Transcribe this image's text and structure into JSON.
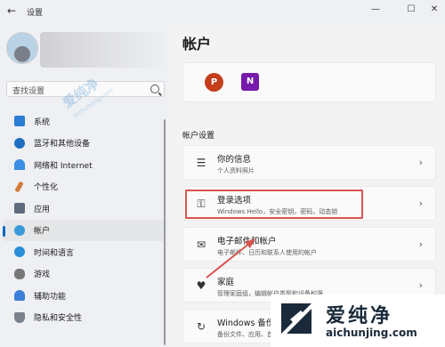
{
  "window": {
    "title": "设置",
    "back_glyph": "←",
    "controls": [
      "—",
      "☐",
      "✕"
    ]
  },
  "search": {
    "placeholder": "查找设置"
  },
  "sidebar": {
    "items": [
      {
        "label": "系统",
        "icon": "system-icon",
        "color": "#2b7cd3"
      },
      {
        "label": "蓝牙和其他设备",
        "icon": "bluetooth-icon",
        "color": "#1f6fbf"
      },
      {
        "label": "网络和 Internet",
        "icon": "wifi-icon",
        "color": "#3a8ee6"
      },
      {
        "label": "个性化",
        "icon": "brush-icon",
        "color": "#d07a3b"
      },
      {
        "label": "应用",
        "icon": "apps-icon",
        "color": "#5d6b7c"
      },
      {
        "label": "帐户",
        "icon": "account-icon",
        "color": "#3a9ad9",
        "active": true
      },
      {
        "label": "时间和语言",
        "icon": "globe-icon",
        "color": "#2a8fd8"
      },
      {
        "label": "游戏",
        "icon": "game-icon",
        "color": "#777777"
      },
      {
        "label": "辅助功能",
        "icon": "accessibility-icon",
        "color": "#3b7dd8"
      },
      {
        "label": "隐私和安全性",
        "icon": "shield-icon",
        "color": "#7a828c"
      }
    ]
  },
  "main": {
    "title": "帐户",
    "apps": [
      {
        "name": "PowerPoint",
        "glyph": "P"
      },
      {
        "name": "OneNote",
        "glyph": "N"
      }
    ],
    "section_title": "帐户设置",
    "cards": [
      {
        "title": "你的信息",
        "sub": "个人资料照片",
        "icon_glyph": "☰"
      },
      {
        "title": "登录选项",
        "sub": "Windows Hello，安全密钥，密码，动态锁",
        "icon_glyph": "⚿"
      },
      {
        "title": "电子邮件和帐户",
        "sub": "电子邮件、日历和联系人使用的帐户",
        "icon_glyph": "✉"
      },
      {
        "title": "家庭",
        "sub": "管理家庭组，编辑帐户类型和设备权限",
        "icon_glyph": "♥"
      },
      {
        "title": "Windows 备份",
        "sub": "备份文件、应用、首选项以…",
        "icon_glyph": "↻"
      }
    ],
    "chevron": "›"
  },
  "watermark": {
    "brand": "爱纯净",
    "url": "aichunjing.com"
  }
}
